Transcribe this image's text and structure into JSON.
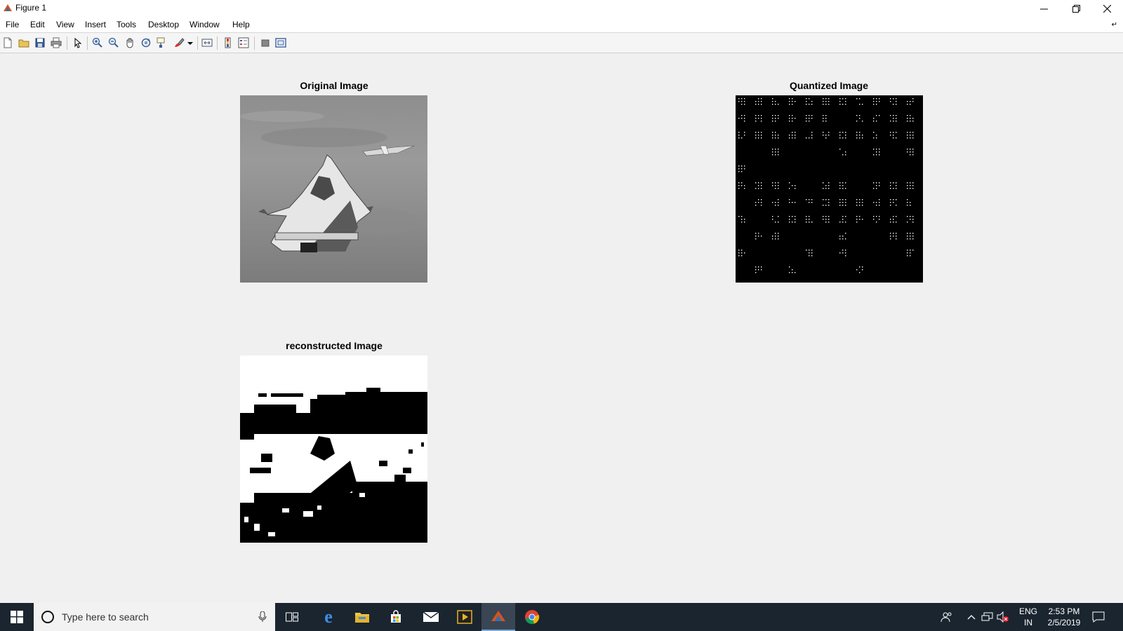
{
  "window": {
    "title": "Figure 1"
  },
  "menu": {
    "items": [
      "File",
      "Edit",
      "View",
      "Insert",
      "Tools",
      "Desktop",
      "Window",
      "Help"
    ]
  },
  "toolbar": {
    "buttons": [
      "new-figure-icon",
      "open-file-icon",
      "save-icon",
      "print-icon",
      "edit-plot-icon",
      "zoom-in-icon",
      "zoom-out-icon",
      "pan-icon",
      "rotate-3d-icon",
      "data-cursor-icon",
      "brush-icon",
      "link-plot-icon",
      "insert-colorbar-icon",
      "insert-legend-icon",
      "hide-plot-tools-icon",
      "show-plot-tools-icon"
    ]
  },
  "figure": {
    "axes": [
      {
        "title": "Original Image"
      },
      {
        "title": "Quantized Image"
      },
      {
        "title": "reconstructed Image"
      }
    ]
  },
  "taskbar": {
    "search_placeholder": "Type here to search",
    "apps": [
      "task-view-icon",
      "edge-icon",
      "file-explorer-icon",
      "store-icon",
      "mail-icon",
      "media-icon",
      "matlab-icon",
      "chrome-icon"
    ],
    "tray": {
      "language": "ENG",
      "region": "IN",
      "time": "2:53 PM",
      "date": "2/5/2019"
    }
  },
  "colors": {
    "taskbar_bg": "#1a2530",
    "figure_bg": "#f0f0f0",
    "matlab_orange": "#d9531e"
  }
}
